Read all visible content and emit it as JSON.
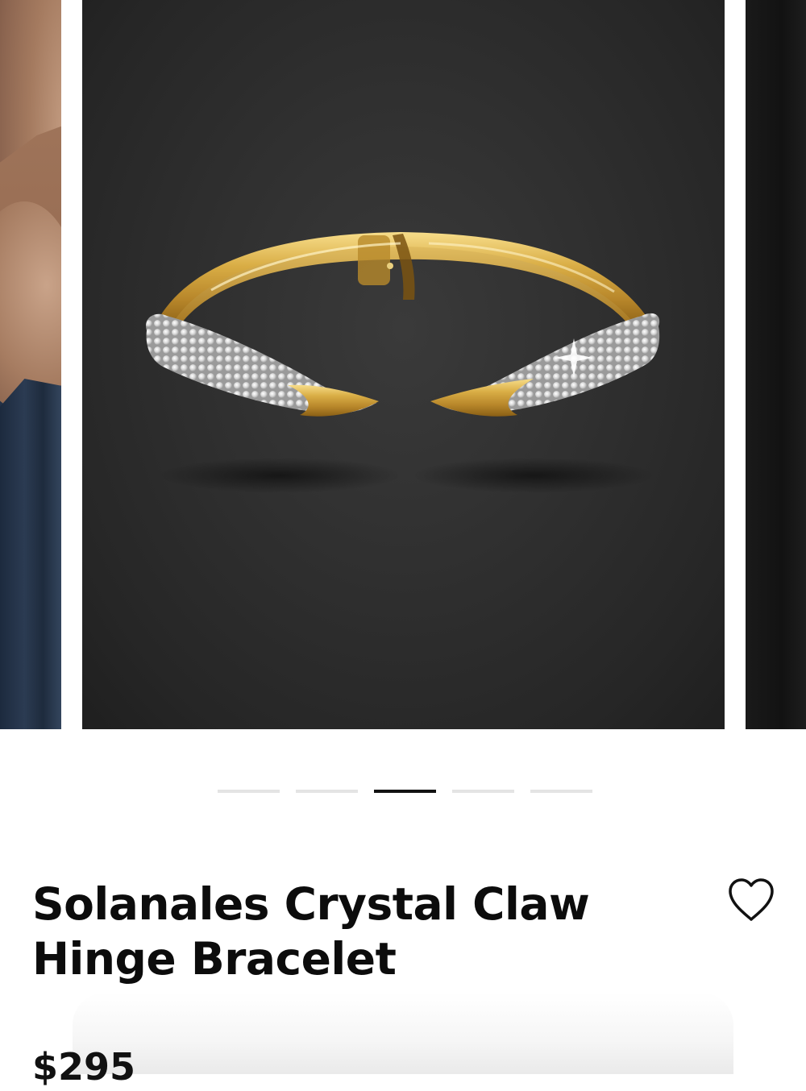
{
  "product": {
    "title_line1": "Solanales Crystal Claw",
    "title_line2": "Hinge Bracelet",
    "price": "$295",
    "image_alt": "Solanales Crystal Claw Hinge Bracelet"
  },
  "carousel": {
    "slide_count": 5,
    "active_index": 2
  },
  "colors": {
    "gold": "#d6a93b",
    "pave": "#e6e6e6",
    "background": "#2e2e2e",
    "active_dot": "#111111",
    "inactive_dot": "#e4e4e4"
  },
  "icons": {
    "wishlist": "heart-outline-icon"
  }
}
